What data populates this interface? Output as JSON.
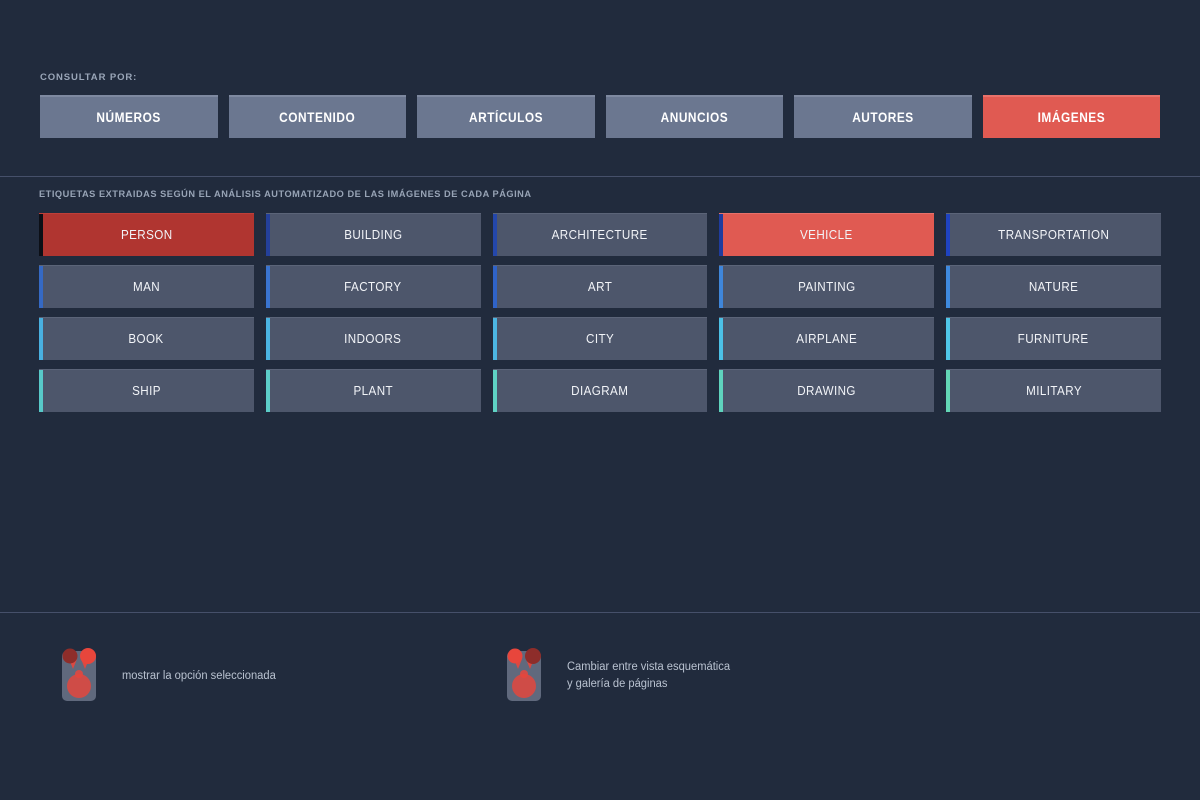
{
  "query": {
    "label": "CONSULTAR POR:",
    "tabs": [
      {
        "label": "NÚMEROS",
        "active": false
      },
      {
        "label": "CONTENIDO",
        "active": false
      },
      {
        "label": "ARTÍCULOS",
        "active": false
      },
      {
        "label": "ANUNCIOS",
        "active": false
      },
      {
        "label": "AUTORES",
        "active": false
      },
      {
        "label": "IMÁGENES",
        "active": true
      }
    ]
  },
  "tags": {
    "caption": "ETIQUETAS EXTRAIDAS SEGÚN EL ANÁLISIS AUTOMATIZADO DE LAS IMÁGENES DE CADA PÁGINA",
    "items": [
      {
        "label": "PERSON",
        "state": "selected-dark",
        "accent": "#0c0f16"
      },
      {
        "label": "BUILDING",
        "state": "default",
        "accent": "#24409a"
      },
      {
        "label": "ARCHITECTURE",
        "state": "default",
        "accent": "#2447ab"
      },
      {
        "label": "VEHICLE",
        "state": "selected-light",
        "accent": "#1f3c9e"
      },
      {
        "label": "TRANSPORTATION",
        "state": "default",
        "accent": "#1f43c0"
      },
      {
        "label": "MAN",
        "state": "default",
        "accent": "#3569c4"
      },
      {
        "label": "FACTORY",
        "state": "default",
        "accent": "#3a74cf"
      },
      {
        "label": "ART",
        "state": "default",
        "accent": "#2f63c9"
      },
      {
        "label": "PAINTING",
        "state": "default",
        "accent": "#3f86da"
      },
      {
        "label": "NATURE",
        "state": "default",
        "accent": "#3f8ade"
      },
      {
        "label": "BOOK",
        "state": "default",
        "accent": "#49b0e0"
      },
      {
        "label": "INDOORS",
        "state": "default",
        "accent": "#4bb4e2"
      },
      {
        "label": "CITY",
        "state": "default",
        "accent": "#4cb6e3"
      },
      {
        "label": "AIRPLANE",
        "state": "default",
        "accent": "#4cc0e6"
      },
      {
        "label": "FURNITURE",
        "state": "default",
        "accent": "#4fc6e8"
      },
      {
        "label": "SHIP",
        "state": "default",
        "accent": "#58c9c9"
      },
      {
        "label": "PLANT",
        "state": "default",
        "accent": "#5ccdc8"
      },
      {
        "label": "DIAGRAM",
        "state": "default",
        "accent": "#5fd2c4"
      },
      {
        "label": "DRAWING",
        "state": "default",
        "accent": "#5fd3bd"
      },
      {
        "label": "MILITARY",
        "state": "default",
        "accent": "#63d6b5"
      }
    ]
  },
  "legend": {
    "items": [
      {
        "icon": "selection-indicator-icon",
        "highlight_side": "right",
        "lines": [
          "mostrar la opción seleccionada"
        ]
      },
      {
        "icon": "view-toggle-icon",
        "highlight_side": "left",
        "lines": [
          "Cambiar entre vista esquemática",
          "y galería de páginas"
        ]
      }
    ]
  },
  "colors": {
    "background": "#212b3d",
    "tab_default": "#6b7790",
    "tab_active": "#e05a52",
    "chip_default": "#4d566b",
    "chip_selected_dark": "#b03530",
    "chip_selected_light": "#e05a52",
    "divider": "#46506a",
    "icon_panel": "#6b7488",
    "icon_dot_bright": "#e8463c",
    "icon_dot_dim": "#8e2d2a"
  }
}
